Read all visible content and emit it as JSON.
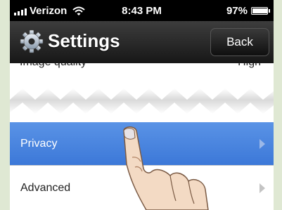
{
  "status_bar": {
    "carrier": "Verizon",
    "time": "8:43 PM",
    "battery": "97%",
    "battery_level": 0.97
  },
  "nav": {
    "title": "Settings",
    "back_label": "Back",
    "icon": "gear-icon"
  },
  "list": {
    "partial_row": {
      "label": "Image quality",
      "value": "High"
    },
    "rows": [
      {
        "label": "Privacy",
        "selected": true
      },
      {
        "label": "Advanced",
        "selected": false
      }
    ]
  },
  "colors": {
    "selected_row": "#3c78d8",
    "nav_bar": "#171717"
  }
}
